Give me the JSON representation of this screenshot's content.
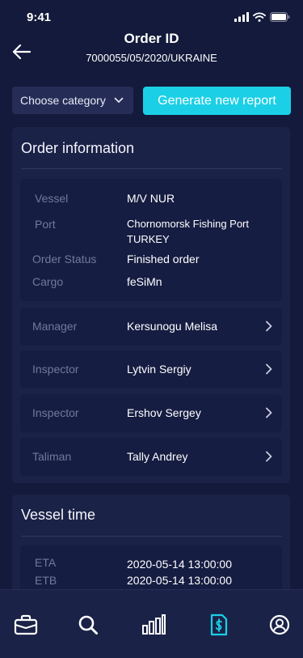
{
  "status": {
    "time": "9:41"
  },
  "header": {
    "title": "Order ID",
    "order_number": "7000055/05/2020/UKRAINE"
  },
  "toolbar": {
    "category_placeholder": "Choose category",
    "generate_label": "Generate new report"
  },
  "order_info": {
    "title": "Order information",
    "details": [
      {
        "label": "Vessel",
        "value": "M/V NUR"
      },
      {
        "label": "Port",
        "value_line1": "Chornomorsk Fishing Port",
        "value_line2": "TURKEY"
      },
      {
        "label": "Order Status",
        "value": "Finished order"
      },
      {
        "label": "Cargo",
        "value": "feSiMn"
      }
    ],
    "people": [
      {
        "role": "Manager",
        "name": "Kersunogu Melisa"
      },
      {
        "role": "Inspector",
        "name": "Lytvin Sergiy"
      },
      {
        "role": "Inspector",
        "name": "Ershov Sergey"
      },
      {
        "role": "Taliman",
        "name": "Tally Andrey"
      }
    ]
  },
  "vessel_time": {
    "title": "Vessel time",
    "rows": [
      {
        "label": "ETA",
        "value": "2020-05-14 13:00:00"
      },
      {
        "label": "ETB",
        "value": "2020-05-14 13:00:00"
      }
    ]
  },
  "tabs": [
    {
      "icon": "briefcase-icon",
      "active": false
    },
    {
      "icon": "search-icon",
      "active": false
    },
    {
      "icon": "bar-chart-icon",
      "active": false
    },
    {
      "icon": "invoice-dollar-icon",
      "active": true
    },
    {
      "icon": "profile-icon",
      "active": false
    }
  ],
  "colors": {
    "background": "#131a3b",
    "card": "#1b2247",
    "accent": "#1bd0e6",
    "muted_label": "#707a9c"
  }
}
